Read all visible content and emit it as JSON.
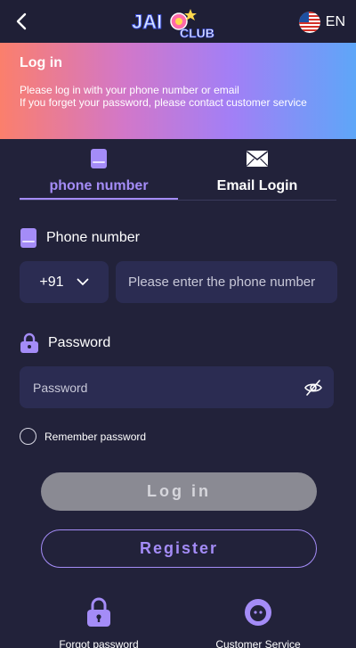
{
  "header": {
    "logo_main": "JAI",
    "logo_sub": "CLUB",
    "language": "EN"
  },
  "banner": {
    "title": "Log in",
    "line1": "Please log in with your phone number or email",
    "line2": "If you forget your password, please contact customer service"
  },
  "tabs": [
    {
      "label": "phone number",
      "icon": "phone-icon",
      "active": true
    },
    {
      "label": "Email Login",
      "icon": "envelope-icon",
      "active": false
    }
  ],
  "phone": {
    "label": "Phone number",
    "country_code": "+91",
    "placeholder": "Please enter the phone number",
    "value": ""
  },
  "password": {
    "label": "Password",
    "placeholder": "Password",
    "value": ""
  },
  "remember_label": "Remember password",
  "buttons": {
    "login": "Log in",
    "register": "Register"
  },
  "footer": {
    "forgot": "Forgot password",
    "service": "Customer Service"
  },
  "colors": {
    "background": "#22223a",
    "accent": "#a48cf7",
    "input_bg": "#2b2c52",
    "login_disabled": "#8a8a93"
  }
}
